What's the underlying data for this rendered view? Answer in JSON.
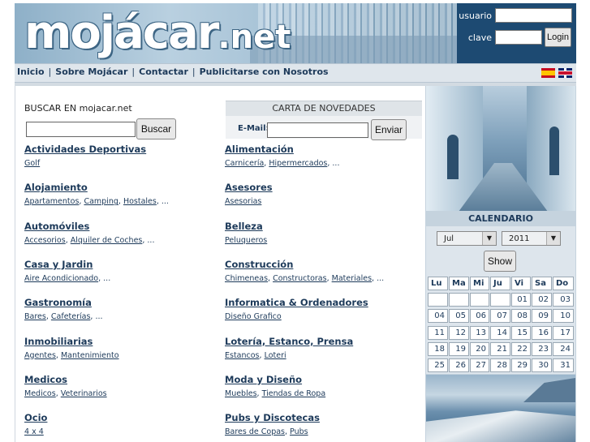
{
  "header": {
    "logo_main": "mojácar",
    "logo_suffix": ".net",
    "login": {
      "user_label": "usuario",
      "pass_label": "clave",
      "user_value": "",
      "pass_value": "",
      "button": "Login"
    }
  },
  "nav": {
    "items": [
      "Inicio",
      "Sobre Mojácar",
      "Contactar",
      "Publicitarse con Nosotros"
    ],
    "flags": [
      "spanish-flag-icon",
      "uk-flag-icon"
    ]
  },
  "search": {
    "label": "BUSCAR EN mojacar.net",
    "input_value": "",
    "button": "Buscar"
  },
  "newsletter": {
    "title": "CARTA DE NOVEDADES",
    "email_label": "E-Mail:",
    "input_value": "",
    "button": "Enviar"
  },
  "categories_left": [
    {
      "title": "Actividades Deportivas",
      "subs": [
        "Golf"
      ],
      "more": false
    },
    {
      "title": "Alojamiento",
      "subs": [
        "Apartamentos",
        "Camping",
        "Hostales"
      ],
      "more": true
    },
    {
      "title": "Automóviles",
      "subs": [
        "Accesorios",
        "Alquiler de Coches"
      ],
      "more": true
    },
    {
      "title": "Casa y Jardin",
      "subs": [
        "Aire Acondicionado"
      ],
      "more": true
    },
    {
      "title": "Gastronomía",
      "subs": [
        "Bares",
        "Cafeterías"
      ],
      "more": true
    },
    {
      "title": "Inmobiliarias",
      "subs": [
        "Agentes",
        "Mantenimiento"
      ],
      "more": false
    },
    {
      "title": "Medicos",
      "subs": [
        "Medicos",
        "Veterinarios"
      ],
      "more": false
    },
    {
      "title": "Ocio",
      "subs": [
        "4 x 4"
      ],
      "more": false
    }
  ],
  "categories_right": [
    {
      "title": "Alimentación",
      "subs": [
        "Carnicería",
        "Hipermercados"
      ],
      "more": true
    },
    {
      "title": "Asesores",
      "subs": [
        "Asesorias"
      ],
      "more": false
    },
    {
      "title": "Belleza",
      "subs": [
        "Peluqueros"
      ],
      "more": false
    },
    {
      "title": "Construcción",
      "subs": [
        "Chimeneas",
        "Constructoras",
        "Materiales"
      ],
      "more": true
    },
    {
      "title": "Informatica & Ordenadores",
      "subs": [
        "Diseño Grafico"
      ],
      "more": false
    },
    {
      "title": "Lotería, Estanco, Prensa",
      "subs": [
        "Estancos",
        "Loteri"
      ],
      "more": false
    },
    {
      "title": "Moda y Diseño",
      "subs": [
        "Muebles",
        "Tiendas de Ropa"
      ],
      "more": false
    },
    {
      "title": "Pubs y Discotecas",
      "subs": [
        "Bares de Copas",
        "Pubs"
      ],
      "more": false
    }
  ],
  "more_text": "...",
  "calendar": {
    "title": "CALENDARIO",
    "month": "Jul",
    "year": "2011",
    "show_button": "Show",
    "day_headers": [
      "Lu",
      "Ma",
      "Mi",
      "Ju",
      "Vi",
      "Sa",
      "Do"
    ],
    "weeks": [
      [
        "",
        "",
        "",
        "",
        "01",
        "02",
        "03"
      ],
      [
        "04",
        "05",
        "06",
        "07",
        "08",
        "09",
        "10"
      ],
      [
        "11",
        "12",
        "13",
        "14",
        "15",
        "16",
        "17"
      ],
      [
        "18",
        "19",
        "20",
        "21",
        "22",
        "23",
        "24"
      ],
      [
        "25",
        "26",
        "27",
        "28",
        "29",
        "30",
        "31"
      ]
    ]
  },
  "colors": {
    "header_bg": "#1d4a72",
    "link": "#1d3a5a",
    "sidebar_bg": "#c5d3de"
  }
}
